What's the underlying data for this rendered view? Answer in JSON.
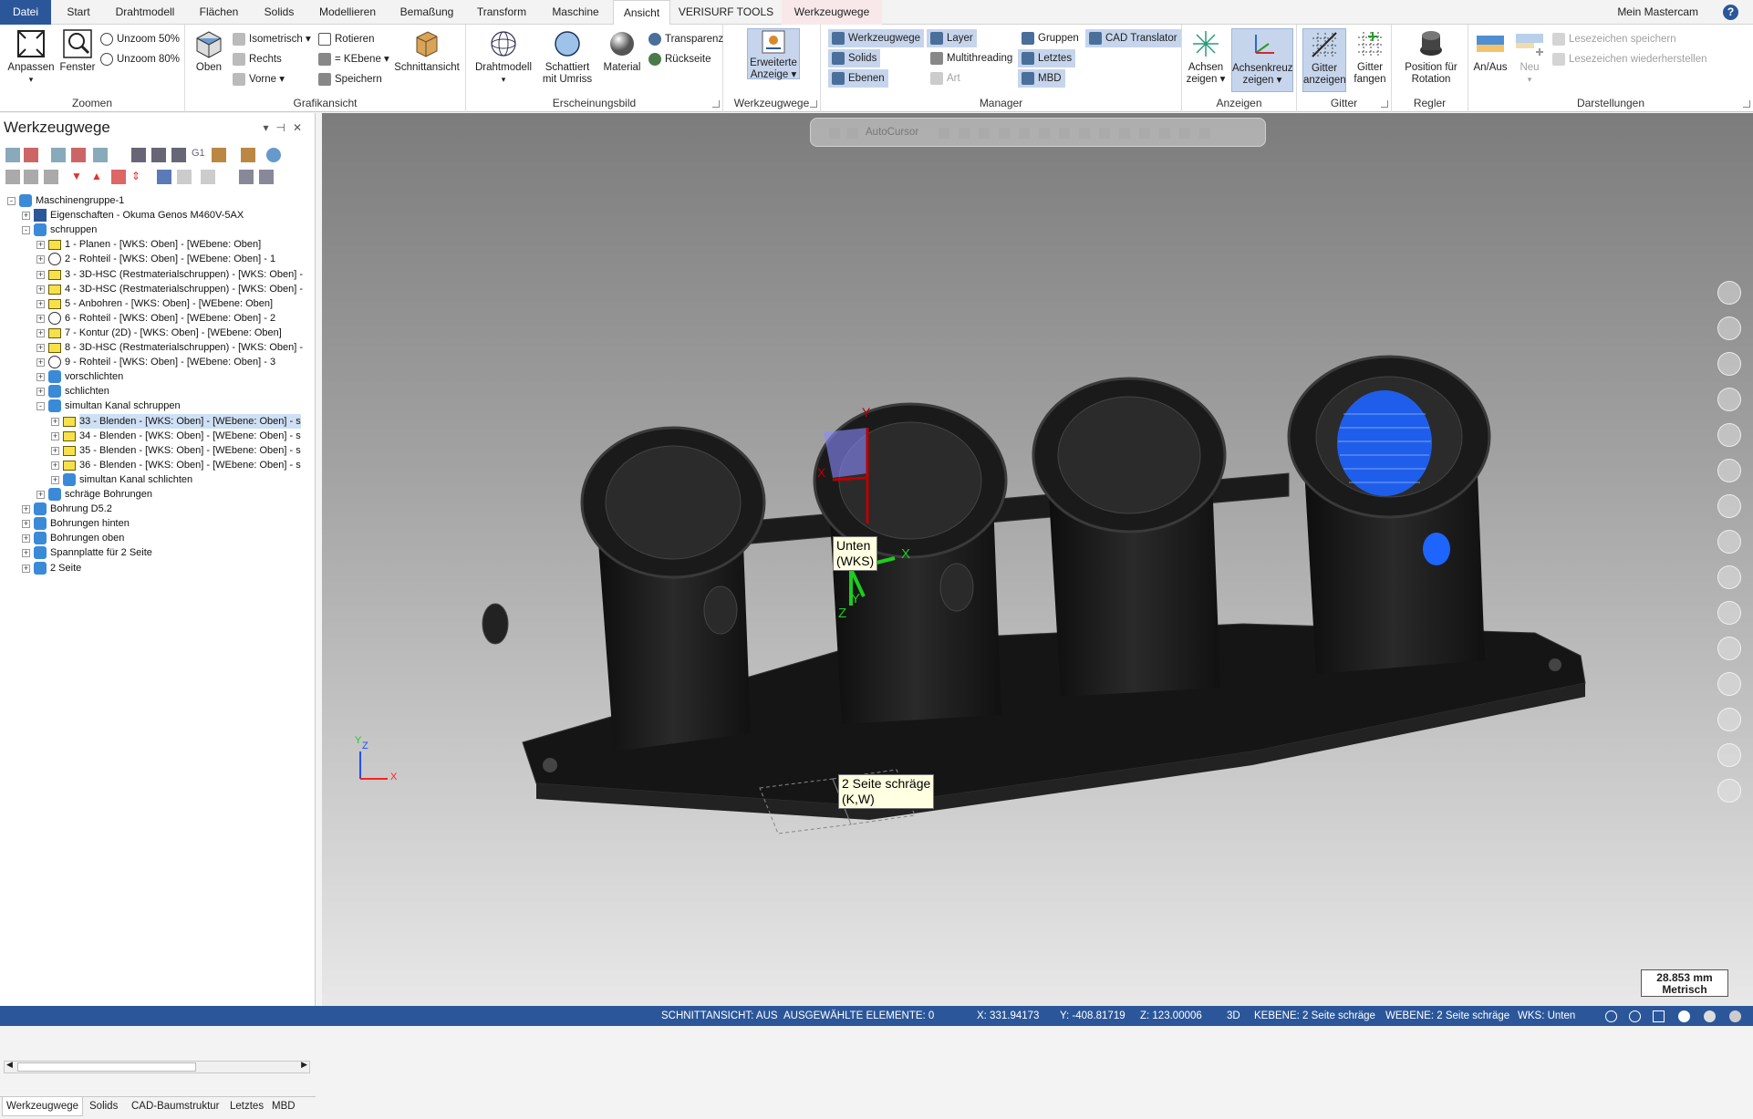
{
  "tabs": [
    "Datei",
    "Start",
    "Drahtmodell",
    "Flächen",
    "Solids",
    "Modellieren",
    "Bemaßung",
    "Transform",
    "Maschine",
    "Ansicht",
    "VERISURF TOOLS",
    "Werkzeugwege"
  ],
  "active_tab": "Ansicht",
  "user": "Mein Mastercam",
  "ribbon": {
    "zoom": {
      "label": "Zoomen",
      "anpassen": "Anpassen",
      "fenster": "Fenster",
      "unzoom50": "Unzoom 50%",
      "unzoom80": "Unzoom 80%"
    },
    "grafik": {
      "label": "Grafikansicht",
      "oben": "Oben",
      "isometrisch": "Isometrisch",
      "rechts": "Rechts",
      "vorne": "Vorne",
      "rotieren": "Rotieren",
      "kebene": "= KEbene",
      "speichern": "Speichern",
      "schnitt": "Schnittansicht"
    },
    "erscheinung": {
      "label": "Erscheinungsbild",
      "draht": "Drahtmodell",
      "schattiert1": "Schattiert",
      "schattiert2": "mit Umriss",
      "material": "Material",
      "transparenz": "Transparenz",
      "rueckseite": "Rückseite"
    },
    "werkzeugwege": {
      "label": "Werkzeugwege",
      "erweitert1": "Erweiterte",
      "erweitert2": "Anzeige"
    },
    "manager": {
      "label": "Manager",
      "werkzeugwege": "Werkzeugwege",
      "solids": "Solids",
      "ebenen": "Ebenen",
      "layer": "Layer",
      "multithreading": "Multithreading",
      "art": "Art",
      "gruppen": "Gruppen",
      "letztes": "Letztes",
      "mbd": "MBD",
      "cad": "CAD Translator"
    },
    "anzeigen": {
      "label": "Anzeigen",
      "achsen1": "Achsen",
      "achsen2": "zeigen",
      "kreuz1": "Achsenkreuz",
      "kreuz2": "zeigen"
    },
    "gitter": {
      "label": "Gitter",
      "anzeigen1": "Gitter",
      "anzeigen2": "anzeigen",
      "fangen1": "Gitter",
      "fangen2": "fangen"
    },
    "regler": {
      "label": "Regler",
      "pos1": "Position für",
      "pos2": "Rotation"
    },
    "darstellungen": {
      "label": "Darstellungen",
      "anaus": "An/Aus",
      "neu": "Neu",
      "lesespeichern": "Lesezeichen speichern",
      "lesewieder": "Lesezeichen wiederherstellen"
    }
  },
  "panel": {
    "title": "Werkzeugwege",
    "tree": [
      {
        "text": "Maschinengruppe-1",
        "level": 0,
        "icon": "group",
        "exp": "-"
      },
      {
        "text": "Eigenschaften - Okuma Genos M460V-5AX",
        "level": 1,
        "icon": "props",
        "exp": "+"
      },
      {
        "text": "schruppen",
        "level": 1,
        "icon": "group",
        "exp": "-"
      },
      {
        "text": "1 - Planen - [WKS: Oben] - [WEbene: Oben]",
        "level": 2,
        "icon": "folder",
        "exp": "+"
      },
      {
        "text": "2 - Rohteil - [WKS: Oben] - [WEbene: Oben] - 1",
        "level": 2,
        "icon": "stock",
        "exp": "+"
      },
      {
        "text": "3 - 3D-HSC (Restmaterialschruppen) - [WKS: Oben] -",
        "level": 2,
        "icon": "folder",
        "exp": "+"
      },
      {
        "text": "4 - 3D-HSC (Restmaterialschruppen) - [WKS: Oben] -",
        "level": 2,
        "icon": "folder",
        "exp": "+"
      },
      {
        "text": "5 - Anbohren - [WKS: Oben] - [WEbene: Oben]",
        "level": 2,
        "icon": "folder",
        "exp": "+"
      },
      {
        "text": "6 - Rohteil - [WKS: Oben] - [WEbene: Oben] - 2",
        "level": 2,
        "icon": "stock",
        "exp": "+"
      },
      {
        "text": "7 - Kontur (2D) - [WKS: Oben] - [WEbene: Oben]",
        "level": 2,
        "icon": "folder",
        "exp": "+"
      },
      {
        "text": "8 - 3D-HSC (Restmaterialschruppen) - [WKS: Oben] -",
        "level": 2,
        "icon": "folder",
        "exp": "+"
      },
      {
        "text": "9 - Rohteil - [WKS: Oben] - [WEbene: Oben] - 3",
        "level": 2,
        "icon": "stock",
        "exp": "+"
      },
      {
        "text": "vorschlichten",
        "level": 2,
        "icon": "group",
        "exp": "+"
      },
      {
        "text": "schlichten",
        "level": 2,
        "icon": "group",
        "exp": "+"
      },
      {
        "text": "simultan Kanal schruppen",
        "level": 2,
        "icon": "group",
        "exp": "-"
      },
      {
        "text": "33 - Blenden - [WKS: Oben] - [WEbene: Oben] - s",
        "level": 3,
        "icon": "folder-check",
        "exp": "+",
        "sel": true
      },
      {
        "text": "34 - Blenden - [WKS: Oben] - [WEbene: Oben] - s",
        "level": 3,
        "icon": "folder",
        "exp": "+"
      },
      {
        "text": "35 - Blenden - [WKS: Oben] - [WEbene: Oben] - s",
        "level": 3,
        "icon": "folder",
        "exp": "+"
      },
      {
        "text": "36 - Blenden - [WKS: Oben] - [WEbene: Oben] - s",
        "level": 3,
        "icon": "folder",
        "exp": "+"
      },
      {
        "text": "simultan Kanal schlichten",
        "level": 3,
        "icon": "group",
        "exp": "+"
      },
      {
        "text": "schräge Bohrungen",
        "level": 2,
        "icon": "group",
        "exp": "+"
      },
      {
        "text": "Bohrung D5.2",
        "level": 1,
        "icon": "group",
        "exp": "+"
      },
      {
        "text": "Bohrungen hinten",
        "level": 1,
        "icon": "group",
        "exp": "+"
      },
      {
        "text": "Bohrungen oben",
        "level": 1,
        "icon": "group",
        "exp": "+"
      },
      {
        "text": "Spannplatte für 2 Seite",
        "level": 1,
        "icon": "group",
        "exp": "+"
      },
      {
        "text": "2 Seite",
        "level": 1,
        "icon": "group",
        "exp": "+"
      }
    ],
    "bottom_tabs": [
      "Werkzeugwege",
      "Solids",
      "CAD-Baumstruktur",
      "Letztes",
      "MBD"
    ]
  },
  "viewport": {
    "autocursor": "AutoCursor",
    "tooltip1_line1": "Unten",
    "tooltip1_line2": "(WKS)",
    "tooltip2_line1": "2 Seite schräge",
    "tooltip2_line2": "(K,W)",
    "axis_x": "X",
    "axis_y": "Y",
    "axis_z": "Z",
    "scale_value": "28.853 mm",
    "scale_unit": "Metrisch"
  },
  "status": {
    "schnitt": "SCHNITTANSICHT: AUS",
    "elemente": "AUSGEWÄHLTE ELEMENTE: 0",
    "x": "X:  331.94173",
    "y": "Y:  -408.81719",
    "z": "Z:  123.00006",
    "mode": "3D",
    "kebene": "KEBENE: 2 Seite schräge",
    "webene": "WEBENE: 2 Seite schräge",
    "wks": "WKS: Unten"
  },
  "colors": {
    "accent": "#2b579a",
    "selection": "#c6d5ec",
    "context_tab": "#f9e8ea",
    "folder": "#f6e14a",
    "toolpath": "#1e64ff"
  }
}
